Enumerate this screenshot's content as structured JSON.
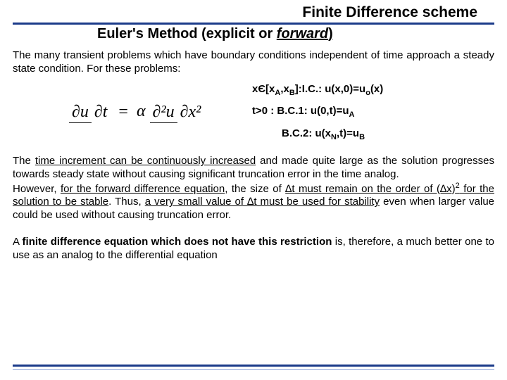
{
  "title_top": "Finite Difference scheme",
  "title_sub_pre": "Euler's Method (explicit or ",
  "title_sub_em": "forward",
  "title_sub_post": ")",
  "intro": "The many transient problems which have boundary conditions independent of time approach a steady state condition. For these problems:",
  "eq_du": "∂u",
  "eq_dt": "∂t",
  "eq_alpha": "α",
  "eq_d2u": "∂²u",
  "eq_dx2": "∂x²",
  "cond_ic_pre": "xЄ[x",
  "cond_ic_A": "A",
  "cond_ic_mid": ",x",
  "cond_ic_B": "B",
  "cond_ic_post": "]:I.C.: u(x,0)=u",
  "cond_ic_o": "o",
  "cond_ic_end": "(x)",
  "cond_bc1_pre": "t>0 : B.C.1: u(0,t)=u",
  "cond_bc1_A": "A",
  "cond_bc2_pre": "B.C.2: u(x",
  "cond_bc2_N": "N",
  "cond_bc2_mid": ",t)=u",
  "cond_bc2_B": "B",
  "p2_u1": "time increment can be continuously increased",
  "p2_t1": " and made quite large as the solution progresses towards steady state without causing significant truncation error in the time analog.",
  "p2_t2a": "However, ",
  "p2_u2": "for the forward difference equation",
  "p2_t2b": ", the size of ",
  "p2_dt": "∆t must remain on the order of (∆x)",
  "p2_sup": "2",
  "p2_t2c": " for the solution to be stable",
  "p2_t2d": ". Thus, ",
  "p2_u3": "a very small value of ∆t must be used for stability",
  "p2_t2e": " even when larger value could be used without causing truncation error.",
  "p3_t1": "A ",
  "p3_b1": "finite difference equation which does not have this restriction",
  "p3_t2": " is, therefore, a much better one to use as an analog to the differential equation"
}
